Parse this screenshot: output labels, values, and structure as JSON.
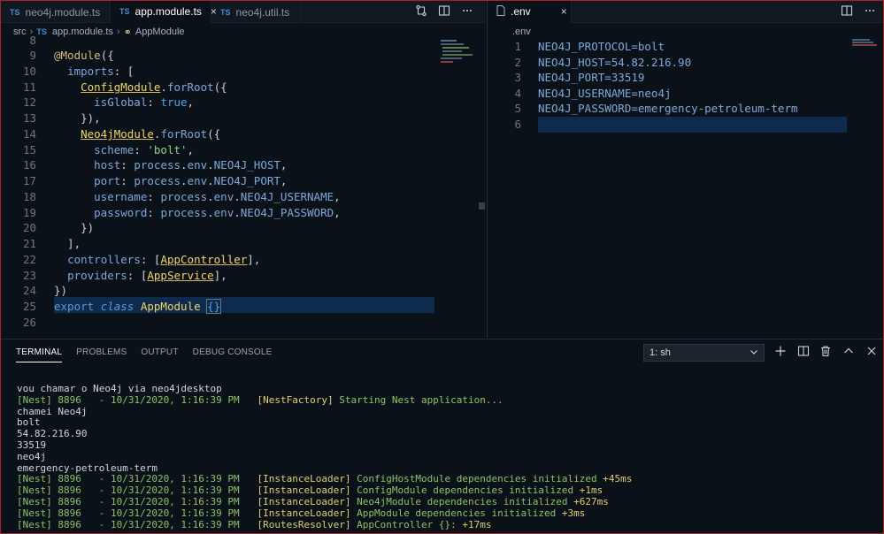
{
  "left_editor": {
    "tabs": [
      {
        "badge": "TS",
        "label": "neo4j.module.ts",
        "active": false
      },
      {
        "badge": "TS",
        "label": "app.module.ts",
        "active": true,
        "close": "×"
      },
      {
        "badge": "TS",
        "label": "neo4j.util.ts",
        "active": false
      }
    ],
    "actions": [
      "compare-icon",
      "split-editor-icon",
      "more-icon"
    ],
    "breadcrumb": [
      "src",
      "app.module.ts",
      "AppModule"
    ],
    "breadcrumb_badge": "TS",
    "code_lines": [
      {
        "n": "8",
        "text": ""
      },
      {
        "n": "9",
        "text": "@Module({"
      },
      {
        "n": "10",
        "text": "  imports: ["
      },
      {
        "n": "11",
        "text": "    ConfigModule.forRoot({"
      },
      {
        "n": "12",
        "text": "      isGlobal: true,"
      },
      {
        "n": "13",
        "text": "    }),"
      },
      {
        "n": "14",
        "text": "    Neo4jModule.forRoot({"
      },
      {
        "n": "15",
        "text": "      scheme: 'bolt',"
      },
      {
        "n": "16",
        "text": "      host: process.env.NEO4J_HOST,"
      },
      {
        "n": "17",
        "text": "      port: process.env.NEO4J_PORT,"
      },
      {
        "n": "18",
        "text": "      username: process.env.NEO4J_USERNAME,"
      },
      {
        "n": "19",
        "text": "      password: process.env.NEO4J_PASSWORD,"
      },
      {
        "n": "20",
        "text": "    })"
      },
      {
        "n": "21",
        "text": "  ],"
      },
      {
        "n": "22",
        "text": "  controllers: [AppController],"
      },
      {
        "n": "23",
        "text": "  providers: [AppService],"
      },
      {
        "n": "24",
        "text": "})"
      },
      {
        "n": "25",
        "text": "export class AppModule {}"
      },
      {
        "n": "26",
        "text": ""
      }
    ]
  },
  "right_editor": {
    "tab": {
      "label": ".env",
      "close": "×"
    },
    "actions": [
      "split-editor-icon",
      "more-icon"
    ],
    "breadcrumb": ".env",
    "lines": [
      {
        "n": "1",
        "text": "NEO4J_PROTOCOL=bolt"
      },
      {
        "n": "2",
        "text": "NEO4J_HOST=54.82.216.90"
      },
      {
        "n": "3",
        "text": "NEO4J_PORT=33519"
      },
      {
        "n": "4",
        "text": "NEO4J_USERNAME=neo4j"
      },
      {
        "n": "5",
        "text": "NEO4J_PASSWORD=emergency-petroleum-term"
      },
      {
        "n": "6",
        "text": ""
      }
    ]
  },
  "panel": {
    "tabs": [
      "TERMINAL",
      "PROBLEMS",
      "OUTPUT",
      "DEBUG CONSOLE"
    ],
    "active_tab": "TERMINAL",
    "terminal_select": "1: sh",
    "terminal_lines": [
      {
        "parts": [
          {
            "t": "vou chamar o Neo4j via neo4jdesktop",
            "c": ""
          }
        ]
      },
      {
        "parts": [
          {
            "t": "[Nest] 8896   - 10/31/2020, 1:16:39 PM   ",
            "c": "t-green"
          },
          {
            "t": "[NestFactory] ",
            "c": "t-yellow"
          },
          {
            "t": "Starting Nest application...",
            "c": "t-green"
          }
        ]
      },
      {
        "parts": [
          {
            "t": "chamei Neo4j",
            "c": ""
          }
        ]
      },
      {
        "parts": [
          {
            "t": "bolt",
            "c": ""
          }
        ]
      },
      {
        "parts": [
          {
            "t": "54.82.216.90",
            "c": ""
          }
        ]
      },
      {
        "parts": [
          {
            "t": "33519",
            "c": ""
          }
        ]
      },
      {
        "parts": [
          {
            "t": "neo4j",
            "c": ""
          }
        ]
      },
      {
        "parts": [
          {
            "t": "emergency-petroleum-term",
            "c": ""
          }
        ]
      },
      {
        "parts": [
          {
            "t": "[Nest] 8896   - 10/31/2020, 1:16:39 PM   ",
            "c": "t-green"
          },
          {
            "t": "[InstanceLoader] ",
            "c": "t-yellow"
          },
          {
            "t": "ConfigHostModule dependencies initialized ",
            "c": "t-green"
          },
          {
            "t": "+45ms",
            "c": "t-yellow"
          }
        ]
      },
      {
        "parts": [
          {
            "t": "[Nest] 8896   - 10/31/2020, 1:16:39 PM   ",
            "c": "t-green"
          },
          {
            "t": "[InstanceLoader] ",
            "c": "t-yellow"
          },
          {
            "t": "ConfigModule dependencies initialized ",
            "c": "t-green"
          },
          {
            "t": "+1ms",
            "c": "t-yellow"
          }
        ]
      },
      {
        "parts": [
          {
            "t": "[Nest] 8896   - 10/31/2020, 1:16:39 PM   ",
            "c": "t-green"
          },
          {
            "t": "[InstanceLoader] ",
            "c": "t-yellow"
          },
          {
            "t": "Neo4jModule dependencies initialized ",
            "c": "t-green"
          },
          {
            "t": "+627ms",
            "c": "t-yellow"
          }
        ]
      },
      {
        "parts": [
          {
            "t": "[Nest] 8896   - 10/31/2020, 1:16:39 PM   ",
            "c": "t-green"
          },
          {
            "t": "[InstanceLoader] ",
            "c": "t-yellow"
          },
          {
            "t": "AppModule dependencies initialized ",
            "c": "t-green"
          },
          {
            "t": "+3ms",
            "c": "t-yellow"
          }
        ]
      },
      {
        "parts": [
          {
            "t": "[Nest] 8896   - 10/31/2020, 1:16:39 PM   ",
            "c": "t-green"
          },
          {
            "t": "[RoutesResolver] ",
            "c": "t-yellow"
          },
          {
            "t": "AppController {}: ",
            "c": "t-green"
          },
          {
            "t": "+17ms",
            "c": "t-yellow"
          }
        ]
      }
    ]
  },
  "colors": {
    "background": "#0b1118",
    "frame_border": "#b0202a",
    "line_highlight": "#0e2a4d",
    "ts_badge": "#3f8fd6"
  }
}
